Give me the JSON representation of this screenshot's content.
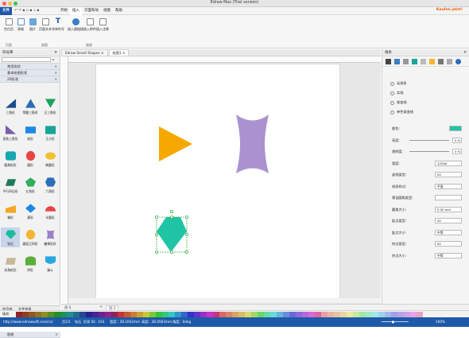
{
  "window": {
    "title": "Edraw Max (Trial version)"
  },
  "ribbon": {
    "file_tab": "文件",
    "tabs": [
      "开始",
      "插入",
      "页面布局",
      "视图",
      "帮助"
    ],
    "buttons": [
      "空白页",
      "表格",
      "图片",
      "页眉文本",
      "字体符号",
      "插入超链接",
      "插入附件",
      "插入注释"
    ],
    "groups": [
      "页面",
      "插图",
      "链接"
    ],
    "user_link": "Kaufen jetzt!",
    "user_link_color": "#e65c00"
  },
  "library": {
    "title": "符号库",
    "search_placeholder": "",
    "categories": [
      "常用形状",
      "基本绘图形状",
      "2D形状"
    ],
    "shapes": [
      {
        "label": "三角形",
        "color": "#1a4e8a",
        "shape": "triangle"
      },
      {
        "label": "等腰三角形",
        "color": "#2a6db6",
        "shape": "isotriangle"
      },
      {
        "label": "正三角形",
        "color": "#1fa35b",
        "shape": "eqtriangle"
      },
      {
        "label": "直角三角形",
        "color": "#7b5ea7",
        "shape": "righttriangle"
      },
      {
        "label": "矩形",
        "color": "#1e88e5",
        "shape": "rect"
      },
      {
        "label": "正方形",
        "color": "#1aa39a",
        "shape": "square"
      },
      {
        "label": "圆角矩形",
        "color": "#18a6b0",
        "shape": "roundrect"
      },
      {
        "label": "圆形",
        "color": "#e84545",
        "shape": "circle"
      },
      {
        "label": "椭圆形",
        "color": "#f2c232",
        "shape": "ellipse"
      },
      {
        "label": "平行四边形",
        "color": "#1b7a5a",
        "shape": "parallelogram"
      },
      {
        "label": "五角形",
        "color": "#2fae5d",
        "shape": "pentagon"
      },
      {
        "label": "六角形",
        "color": "#2c6fb8",
        "shape": "hexagon"
      },
      {
        "label": "梯形",
        "color": "#f5a623",
        "shape": "trapezoid"
      },
      {
        "label": "菱形",
        "color": "#1e88e5",
        "shape": "diamond"
      },
      {
        "label": "半圆形",
        "color": "#e84545",
        "shape": "semicircle"
      },
      {
        "label": "钻石",
        "color": "#1abc9c",
        "shape": "gem"
      },
      {
        "label": "圆弧正四形",
        "color": "#f2b632",
        "shape": "octagonish"
      },
      {
        "label": "糖果形状",
        "color": "#9b7fc7",
        "shape": "candy"
      },
      {
        "label": "折角矩形",
        "color": "#c8b89a",
        "shape": "foldrect"
      },
      {
        "label": "拱形",
        "color": "#5aae3c",
        "shape": "arch"
      },
      {
        "label": "漏斗",
        "color": "#27a8e0",
        "shape": "shield"
      }
    ],
    "bottom_category": "图框",
    "bottom_tabs": [
      "符号库",
      "文件恢复"
    ]
  },
  "documents": {
    "tabs": [
      "Edraw Smart Shapes",
      "绘图1"
    ]
  },
  "canvas": {
    "shapes": [
      {
        "name": "triangle",
        "color": "#f5a800"
      },
      {
        "name": "candy",
        "color": "#a992cf"
      },
      {
        "name": "gem",
        "color": "#1ec4a4"
      }
    ]
  },
  "page_bar": {
    "page": "页-1",
    "current": "页-1"
  },
  "palette_label": "填充",
  "status": {
    "url": "http://www.edrawsoft.com/cn/",
    "page": "页1/1",
    "shape": "钻石",
    "shape_id": "形状 ID：103",
    "width": "宽度：28.1042mm",
    "height": "高度：28.4583mm",
    "angle": "角度：0deg",
    "zoom": "100%"
  },
  "right_panel": {
    "title": "线条",
    "line_options": [
      "无线条",
      "实线",
      "渐变线",
      "单色渐变线"
    ],
    "props": [
      {
        "label": "颜色:",
        "value": ""
      },
      {
        "label": "亮度:",
        "value": "0 %"
      },
      {
        "label": "透明度:",
        "value": "0 %"
      },
      {
        "label": "宽度:",
        "value": "1/20pt"
      },
      {
        "label": "虚线类型:",
        "value": "00"
      },
      {
        "label": "线条样式:",
        "value": "平直"
      },
      {
        "label": "预设圆角类型:",
        "value": ""
      },
      {
        "label": "圆角大小:",
        "value": "0.00 mm"
      },
      {
        "label": "起点类型:",
        "value": "00"
      },
      {
        "label": "起点大小:",
        "value": "中等"
      },
      {
        "label": "终点类型:",
        "value": "00"
      },
      {
        "label": "终点大小:",
        "value": "中等"
      }
    ],
    "line_color": "#1ec4a4"
  }
}
